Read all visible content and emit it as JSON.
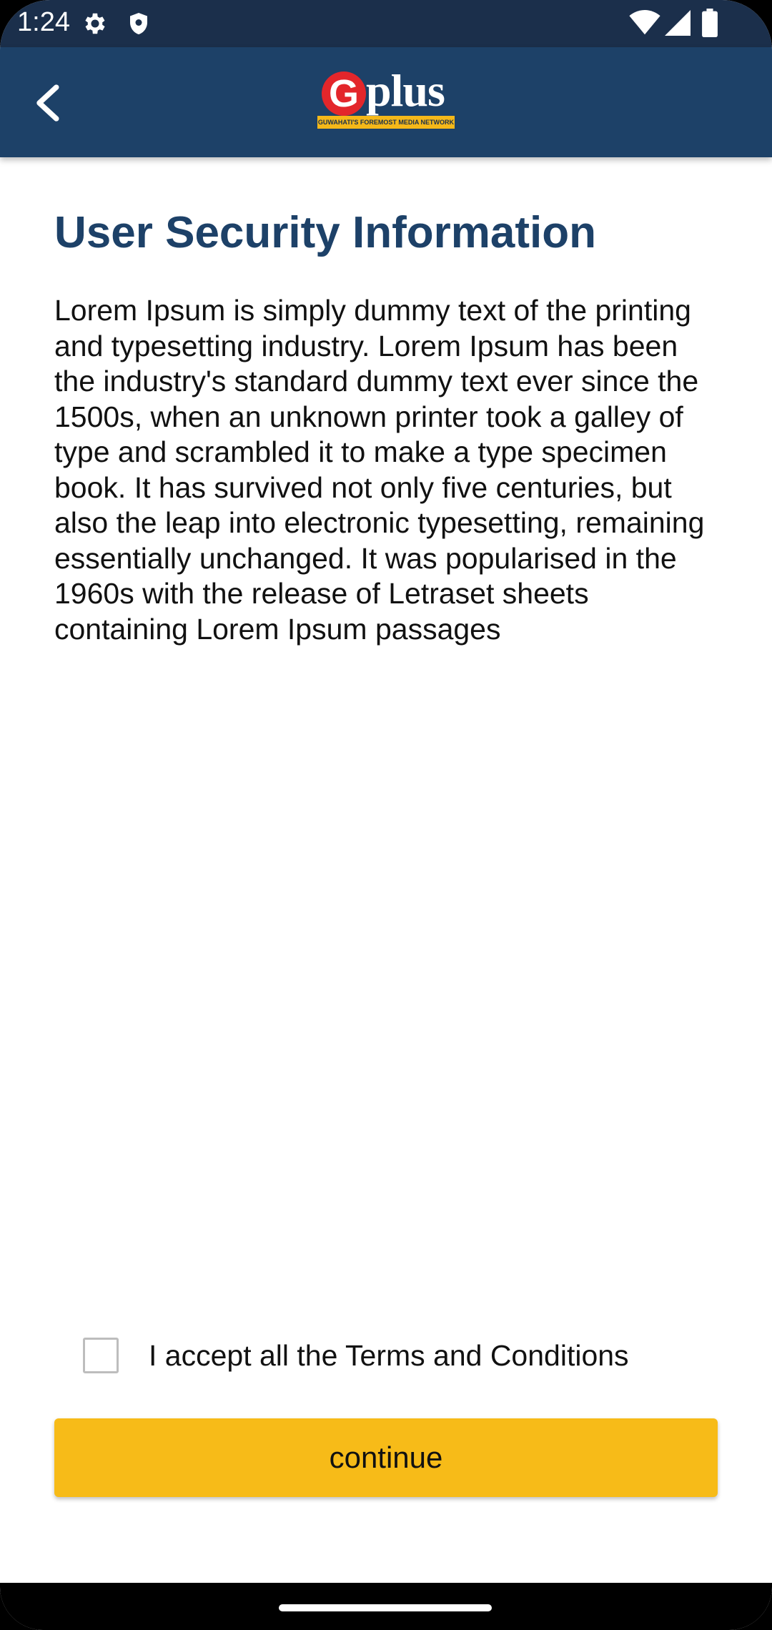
{
  "status_bar": {
    "time": "1:24",
    "icons": [
      "settings-gear-icon",
      "shield-icon",
      "wifi-icon",
      "cellular-signal-icon",
      "battery-icon"
    ]
  },
  "app_bar": {
    "back_icon": "chevron-left-icon",
    "logo": {
      "letter": "G",
      "word": "plus",
      "tagline": "GUWAHATI'S FOREMOST MEDIA NETWORK"
    }
  },
  "content": {
    "title": "User Security Information",
    "body": "Lorem Ipsum is simply dummy text of the printing and typesetting industry. Lorem Ipsum has been the industry's standard dummy text ever since the 1500s, when an unknown printer took a galley of type and scrambled it to make a type specimen book. It has survived not only five centuries, but also the leap into electronic typesetting, remaining essentially unchanged. It was popularised in the 1960s with the release of Letraset sheets containing Lorem Ipsum passages"
  },
  "terms": {
    "label": "I accept all the Terms and Conditions",
    "checked": false
  },
  "continue_button": {
    "label": "continue"
  },
  "colors": {
    "status_bar": "#1b2f4b",
    "app_bar": "#1d4168",
    "title": "#1d4168",
    "accent_button": "#f7bb18",
    "logo_red": "#e3262b"
  }
}
